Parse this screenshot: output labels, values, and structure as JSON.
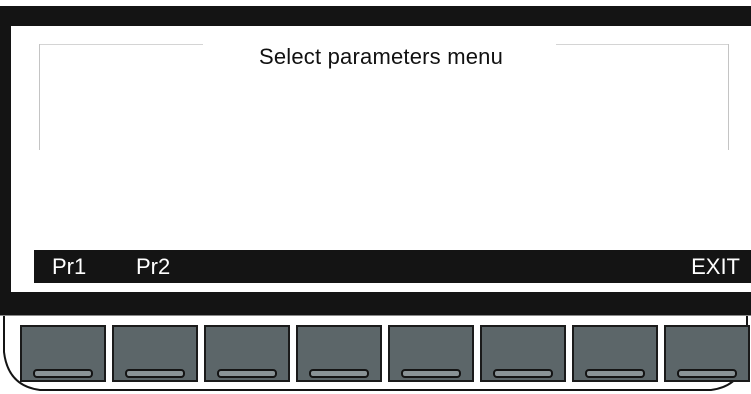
{
  "screen": {
    "title": "Select parameters menu"
  },
  "softkeys": [
    {
      "label": "Pr1"
    },
    {
      "label": "Pr2"
    },
    {
      "label": ""
    },
    {
      "label": ""
    },
    {
      "label": ""
    },
    {
      "label": ""
    },
    {
      "label": ""
    },
    {
      "label": "EXIT"
    }
  ],
  "colors": {
    "bezel": "#141414",
    "screen": "#ffffff",
    "key_face": "#5c6669",
    "label_text": "#ffffff"
  }
}
